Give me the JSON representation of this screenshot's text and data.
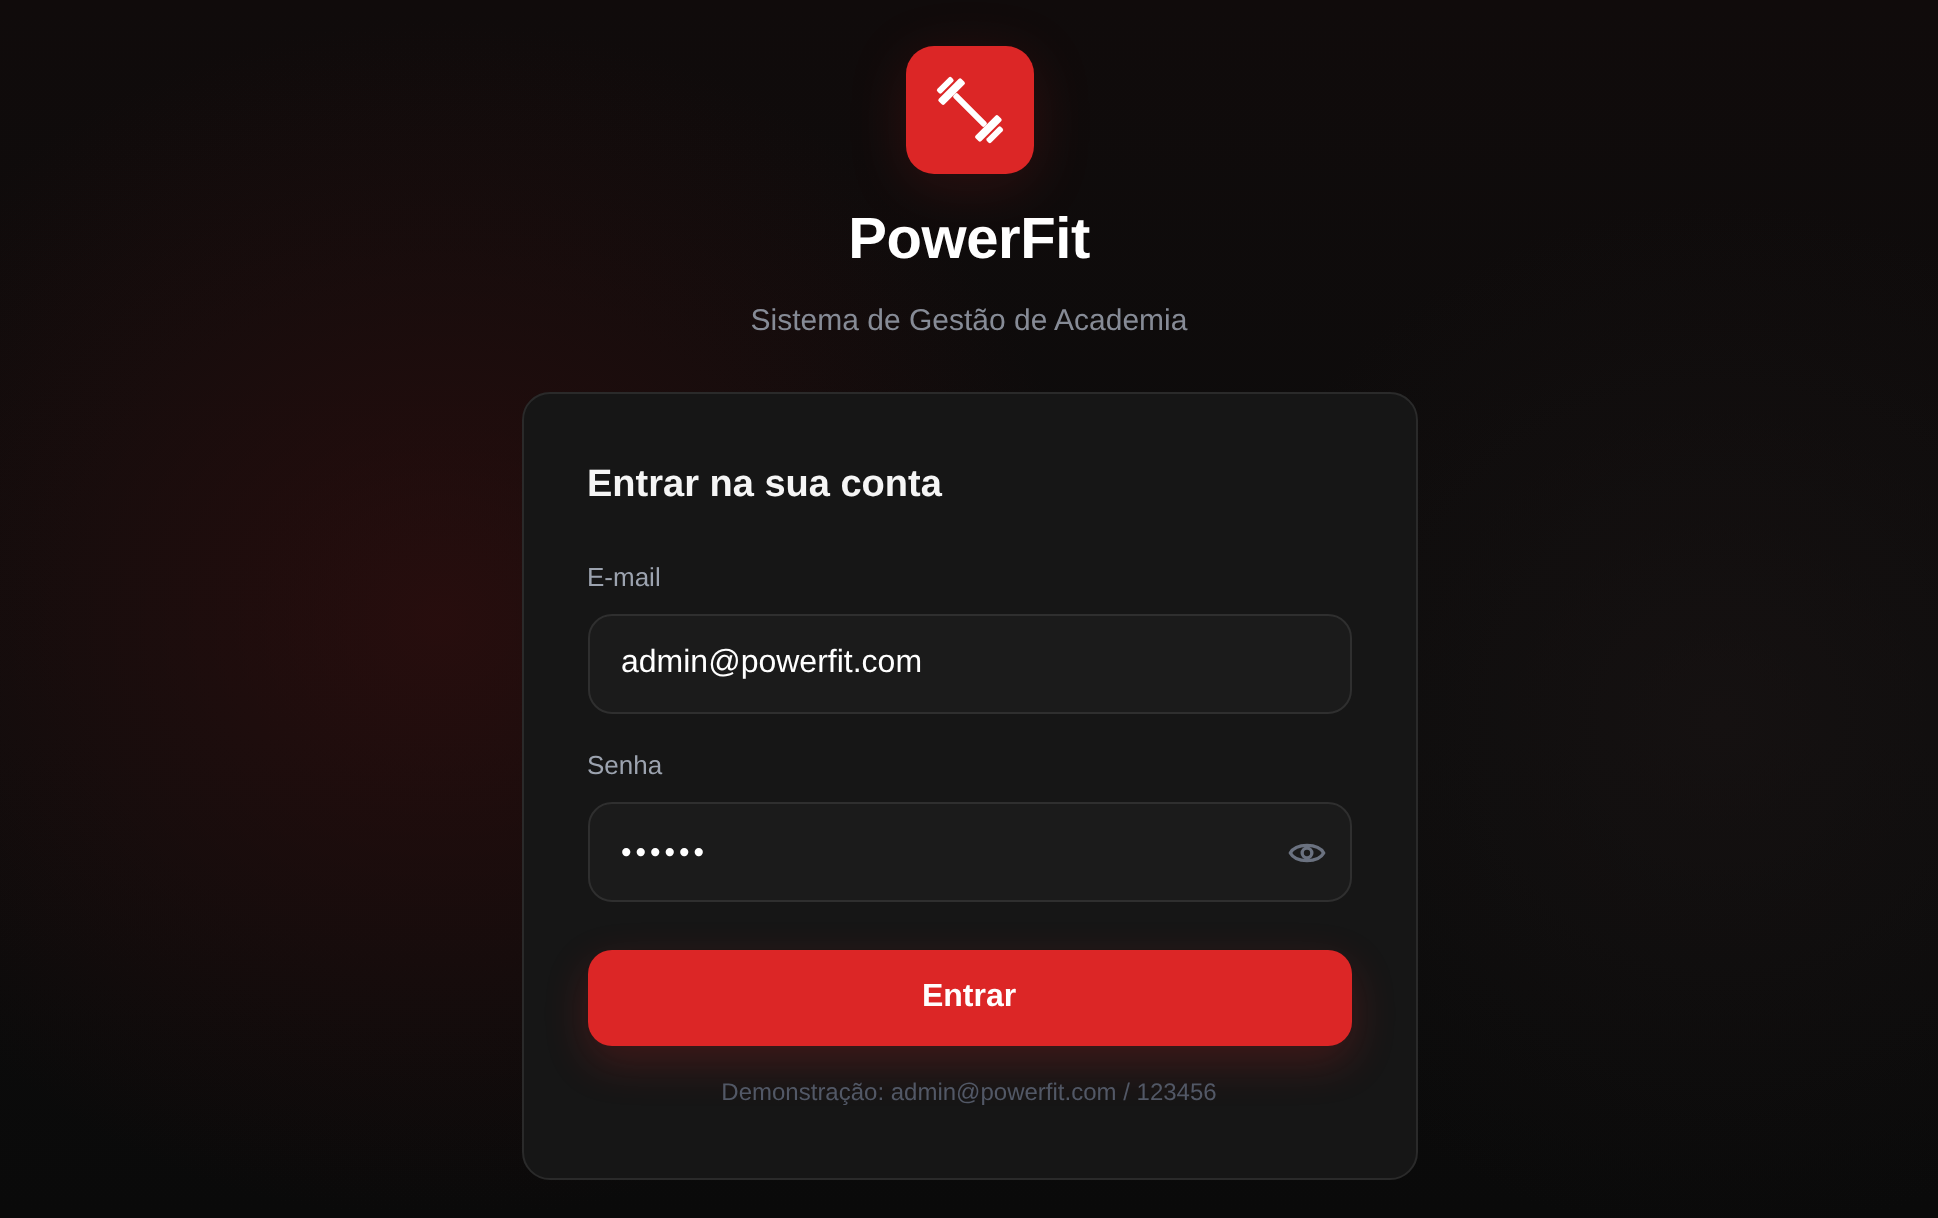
{
  "app": {
    "name": "PowerFit",
    "tagline": "Sistema de Gestão de Academia"
  },
  "login_form": {
    "title": "Entrar na sua conta",
    "fields": [
      {
        "kind": "email",
        "label": "E-mail",
        "value": "admin@powerfit.com"
      },
      {
        "kind": "password",
        "label": "Senha",
        "value": "••••••"
      }
    ],
    "submit_button": "Entrar",
    "demo_hint": "Demonstração: admin@powerfit.com / 123456"
  }
}
